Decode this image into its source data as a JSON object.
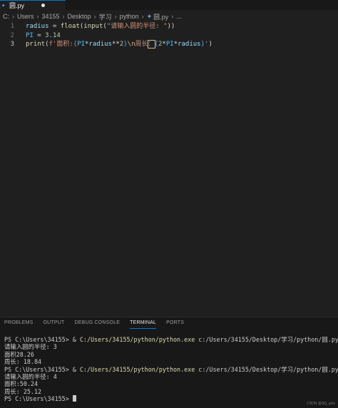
{
  "tab": {
    "label": "圆.py"
  },
  "breadcrumb": [
    "C:",
    "Users",
    "34155",
    "Desktop",
    "学习",
    "python",
    "圆.py",
    "..."
  ],
  "editor": {
    "lines": [
      {
        "num": "1",
        "parts": [
          [
            "radius",
            "kw-var"
          ],
          [
            " = ",
            "op"
          ],
          [
            "float",
            "fn"
          ],
          [
            "(",
            "op"
          ],
          [
            "input",
            "fn"
          ],
          [
            "(",
            "op"
          ],
          [
            "\"请输入圆的半径: \"",
            "str"
          ],
          [
            "))",
            "op"
          ]
        ]
      },
      {
        "num": "2",
        "parts": [
          [
            "PI",
            "kw-const"
          ],
          [
            " = ",
            "op"
          ],
          [
            "3.14",
            "num"
          ]
        ]
      },
      {
        "num": "3",
        "parts": [
          [
            "print",
            "fn"
          ],
          [
            "(",
            "op"
          ],
          [
            "f'面积:",
            "str"
          ],
          [
            "{",
            "brace"
          ],
          [
            "PI",
            "kw-const"
          ],
          [
            "*",
            "op"
          ],
          [
            "radius",
            "kw-var"
          ],
          [
            "**",
            "op"
          ],
          [
            "2",
            "num"
          ],
          [
            "}",
            "brace"
          ],
          [
            "\\n",
            "esc"
          ],
          [
            "周长",
            "str"
          ],
          [
            "：",
            "str hl"
          ],
          [
            "{",
            "brace"
          ],
          [
            "2",
            "num"
          ],
          [
            "*",
            "op"
          ],
          [
            "PI",
            "kw-const"
          ],
          [
            "*",
            "op"
          ],
          [
            "radius",
            "kw-var"
          ],
          [
            "}",
            "brace"
          ],
          [
            "'",
            "str"
          ],
          [
            ")",
            "op"
          ]
        ]
      }
    ]
  },
  "panel": {
    "tabs": [
      "PROBLEMS",
      "OUTPUT",
      "DEBUG CONSOLE",
      "TERMINAL",
      "PORTS"
    ],
    "active_tab": "TERMINAL"
  },
  "terminal": {
    "lines": [
      {
        "prompt": "PS C:\\Users\\34155> & ",
        "cmd": "C:/Users/34155/python/python.exe",
        "rest": " c:/Users/34155/Desktop/学习/python/圆.py"
      },
      {
        "text": "请输入圆的半径: 3"
      },
      {
        "text": "面积28.26"
      },
      {
        "text": "周长: 18.84"
      },
      {
        "prompt": "PS C:\\Users\\34155> & ",
        "cmd": "C:/Users/34155/python/python.exe",
        "rest": " c:/Users/34155/Desktop/学习/python/圆.py"
      },
      {
        "text": "请输入圆的半径: 4"
      },
      {
        "text": "面积:50.24"
      },
      {
        "text": "周长: 25.12"
      },
      {
        "text": "PS C:\\Users\\34155> ",
        "cursor": true
      }
    ]
  },
  "watermark": "CSDN @SQ_yolo"
}
